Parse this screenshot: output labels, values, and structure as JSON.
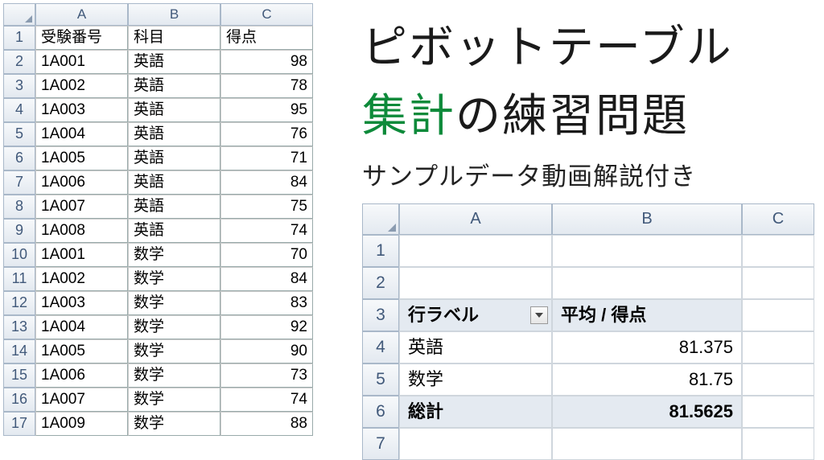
{
  "title": {
    "line1": "ピボットテーブル",
    "line2_accent": "集計",
    "line2_rest": "の練習問題",
    "subtitle": "サンプルデータ動画解説付き"
  },
  "left_table": {
    "col_headers": [
      "A",
      "B",
      "C"
    ],
    "row_headers": [
      "1",
      "2",
      "3",
      "4",
      "5",
      "6",
      "7",
      "8",
      "9",
      "10",
      "11",
      "12",
      "13",
      "14",
      "15",
      "16",
      "17"
    ],
    "header_row": {
      "a": "受験番号",
      "b": "科目",
      "c": "得点"
    },
    "rows": [
      {
        "a": "1A001",
        "b": "英語",
        "c": "98"
      },
      {
        "a": "1A002",
        "b": "英語",
        "c": "78"
      },
      {
        "a": "1A003",
        "b": "英語",
        "c": "95"
      },
      {
        "a": "1A004",
        "b": "英語",
        "c": "76"
      },
      {
        "a": "1A005",
        "b": "英語",
        "c": "71"
      },
      {
        "a": "1A006",
        "b": "英語",
        "c": "84"
      },
      {
        "a": "1A007",
        "b": "英語",
        "c": "75"
      },
      {
        "a": "1A008",
        "b": "英語",
        "c": "74"
      },
      {
        "a": "1A001",
        "b": "数学",
        "c": "70"
      },
      {
        "a": "1A002",
        "b": "数学",
        "c": "84"
      },
      {
        "a": "1A003",
        "b": "数学",
        "c": "83"
      },
      {
        "a": "1A004",
        "b": "数学",
        "c": "92"
      },
      {
        "a": "1A005",
        "b": "数学",
        "c": "90"
      },
      {
        "a": "1A006",
        "b": "数学",
        "c": "73"
      },
      {
        "a": "1A007",
        "b": "数学",
        "c": "74"
      },
      {
        "a": "1A009",
        "b": "数学",
        "c": "88"
      }
    ]
  },
  "pivot": {
    "col_headers": [
      "A",
      "B",
      "C"
    ],
    "row_headers": [
      "1",
      "2",
      "3",
      "4",
      "5",
      "6",
      "7"
    ],
    "header": {
      "a": "行ラベル",
      "b": "平均 / 得点"
    },
    "rows": [
      {
        "a": "英語",
        "b": "81.375"
      },
      {
        "a": "数学",
        "b": "81.75"
      }
    ],
    "total": {
      "a": "総計",
      "b": "81.5625"
    }
  },
  "chart_data": {
    "type": "table",
    "title": "ピボットテーブル集計",
    "source_columns": [
      "受験番号",
      "科目",
      "得点"
    ],
    "aggregation": "average",
    "value_field": "得点",
    "row_field": "科目",
    "result": [
      {
        "category": "英語",
        "value": 81.375
      },
      {
        "category": "数学",
        "value": 81.75
      }
    ],
    "grand_total": 81.5625
  }
}
